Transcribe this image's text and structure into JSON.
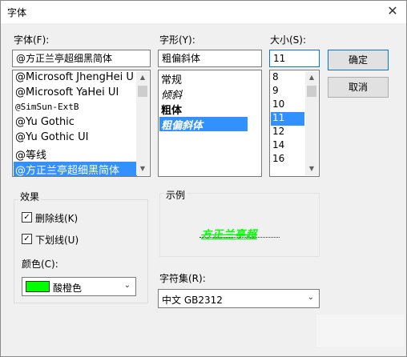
{
  "dialog": {
    "title": "字体",
    "close_glyph": "✕"
  },
  "font": {
    "label": "字体(F):",
    "value": "@方正兰亭超细黑简体",
    "items": [
      "@Microsoft JhengHei U",
      "@Microsoft YaHei UI",
      "@SimSun-ExtB",
      "@Yu Gothic",
      "@Yu Gothic UI",
      "@等线",
      "@方正兰亭超细黑简体"
    ],
    "selected_index": 6
  },
  "style": {
    "label": "字形(Y):",
    "value": "粗偏斜体",
    "items": [
      "常规",
      "倾斜",
      "粗体",
      "粗偏斜体"
    ],
    "selected_index": 3
  },
  "size": {
    "label": "大小(S):",
    "value": "11",
    "items": [
      "8",
      "9",
      "10",
      "11",
      "12",
      "14",
      "16"
    ],
    "selected_index": 3
  },
  "buttons": {
    "ok": "确定",
    "cancel": "取消"
  },
  "effects": {
    "label": "效果",
    "strikeout": {
      "label": "删除线(K)",
      "checked": true
    },
    "underline": {
      "label": "下划线(U)",
      "checked": true
    },
    "color_label": "颜色(C):",
    "color_value": "酸橙色",
    "color_hex": "#00ff00"
  },
  "sample": {
    "label": "示例",
    "text": "方正兰亭超"
  },
  "charset": {
    "label": "字符集(R):",
    "value": "中文 GB2312"
  },
  "icons": {
    "check": "✓",
    "chevron_down": "⌄",
    "scroll_up": "▲",
    "scroll_down": "▼"
  }
}
